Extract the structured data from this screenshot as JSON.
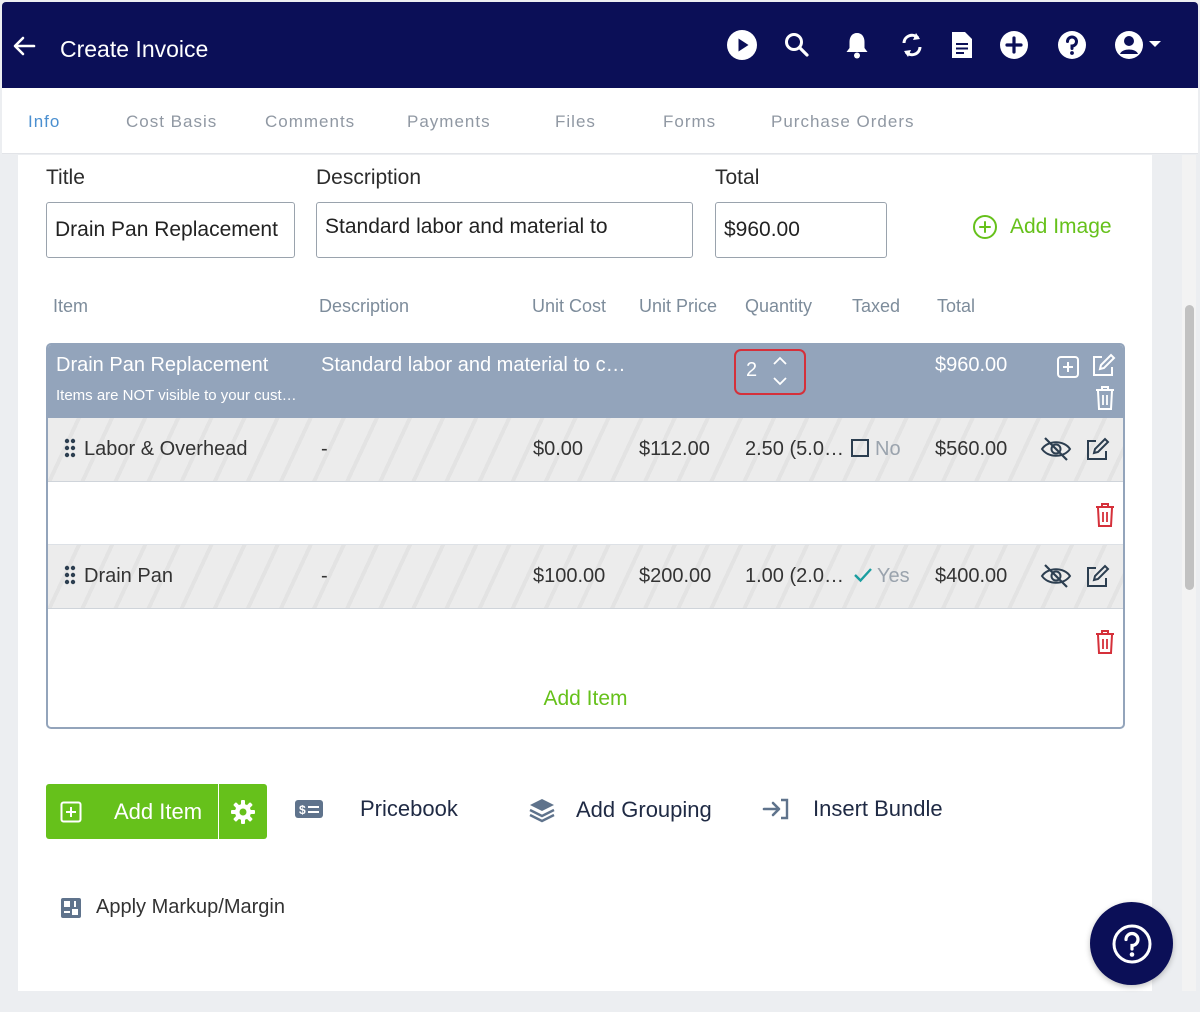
{
  "header": {
    "title": "Create Invoice"
  },
  "tabs": [
    "Info",
    "Cost Basis",
    "Comments",
    "Payments",
    "Files",
    "Forms",
    "Purchase Orders"
  ],
  "form": {
    "title_label": "Title",
    "title_value": "Drain Pan Replacement",
    "description_label": "Description",
    "description_value": "Standard labor and material to",
    "total_label": "Total",
    "total_value": "$960.00",
    "add_image_label": "Add Image"
  },
  "columns": [
    "Item",
    "Description",
    "Unit Cost",
    "Unit Price",
    "Quantity",
    "Taxed",
    "Total"
  ],
  "group": {
    "name": "Drain Pan Replacement",
    "description": "Standard labor and material to c…",
    "note": "Items are NOT visible to your cust…",
    "quantity": "2",
    "total": "$960.00"
  },
  "items": [
    {
      "name": "Labor & Overhead",
      "description": "-",
      "unit_cost": "$0.00",
      "unit_price": "$112.00",
      "quantity": "2.50 (5.0…",
      "taxed": "No",
      "total": "$560.00"
    },
    {
      "name": "Drain Pan",
      "description": "-",
      "unit_cost": "$100.00",
      "unit_price": "$200.00",
      "quantity": "1.00 (2.0…",
      "taxed": "Yes",
      "total": "$400.00"
    }
  ],
  "add_item_link": "Add Item",
  "actions": {
    "add_item": "Add Item",
    "pricebook": "Pricebook",
    "add_grouping": "Add Grouping",
    "insert_bundle": "Insert Bundle",
    "apply_markup": "Apply Markup/Margin"
  },
  "colors": {
    "navy": "#0b0f57",
    "green": "#66c11b",
    "group_header": "#93a4bb",
    "tab_active": "#4a8fd0",
    "delete_red": "#d5303a"
  }
}
